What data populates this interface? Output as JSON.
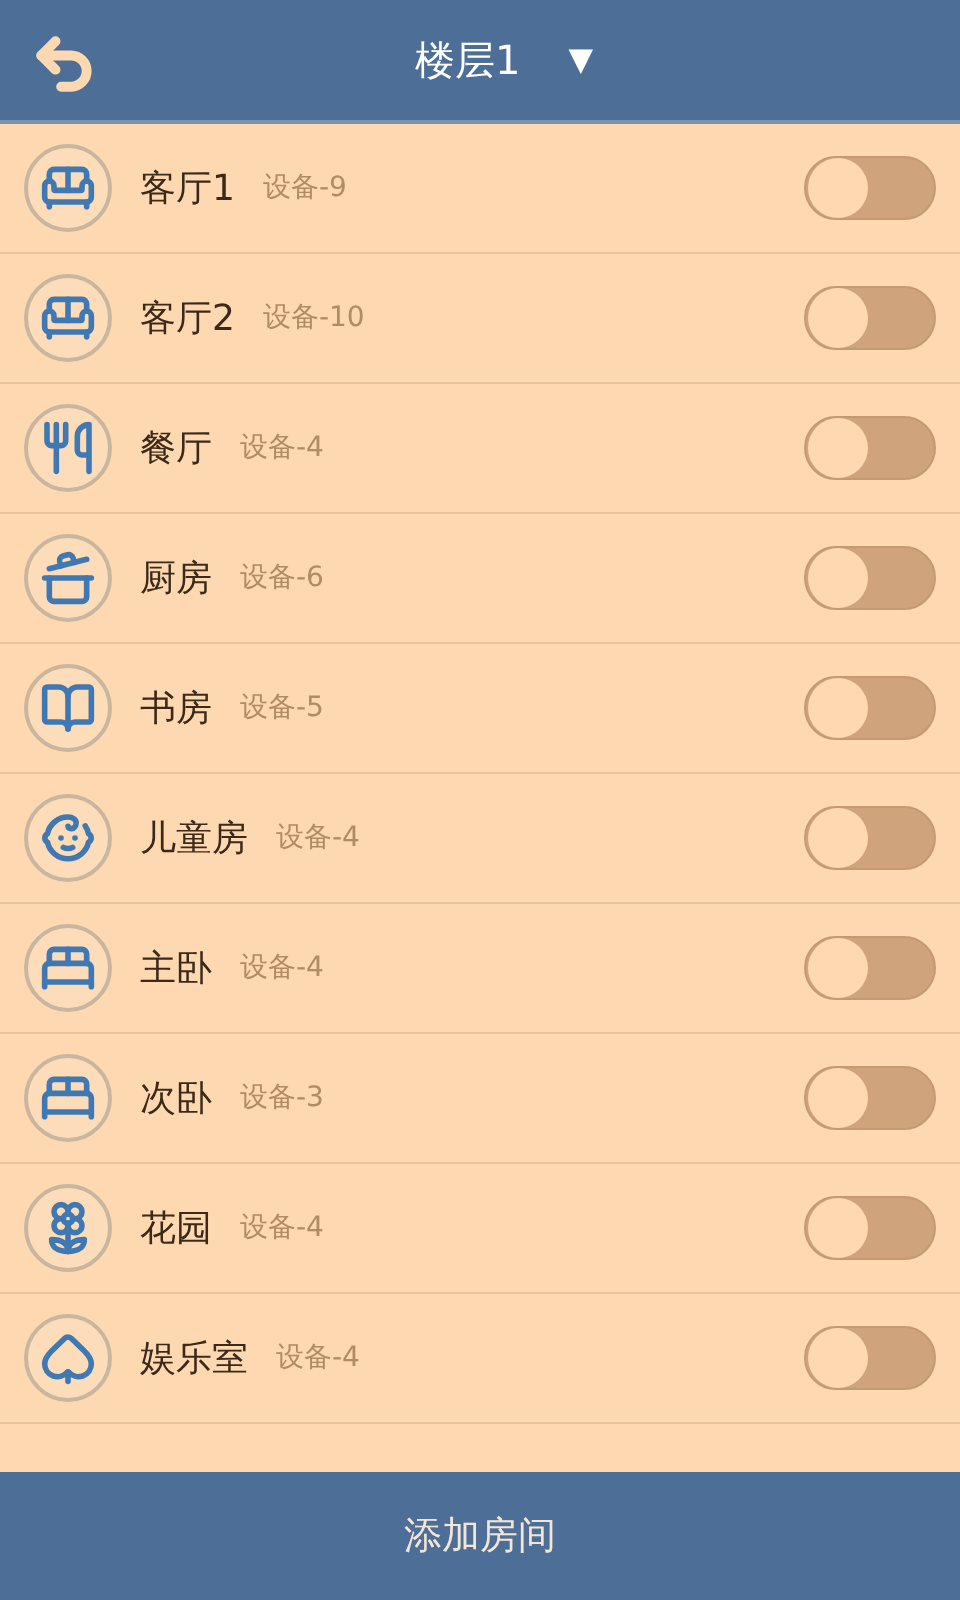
{
  "header": {
    "title": "楼层1",
    "dropdown_glyph": "▼"
  },
  "rooms": [
    {
      "name": "客厅1",
      "devices": "设备-9",
      "kind": "sofa",
      "on": false
    },
    {
      "name": "客厅2",
      "devices": "设备-10",
      "kind": "sofa",
      "on": false
    },
    {
      "name": "餐厅",
      "devices": "设备-4",
      "kind": "dining",
      "on": false
    },
    {
      "name": "厨房",
      "devices": "设备-6",
      "kind": "kitchen",
      "on": false
    },
    {
      "name": "书房",
      "devices": "设备-5",
      "kind": "study",
      "on": false
    },
    {
      "name": "儿童房",
      "devices": "设备-4",
      "kind": "kids",
      "on": false
    },
    {
      "name": "主卧",
      "devices": "设备-4",
      "kind": "bed",
      "on": false
    },
    {
      "name": "次卧",
      "devices": "设备-3",
      "kind": "bed",
      "on": false
    },
    {
      "name": "花园",
      "devices": "设备-4",
      "kind": "garden",
      "on": false
    },
    {
      "name": "娱乐室",
      "devices": "设备-4",
      "kind": "games",
      "on": false
    }
  ],
  "footer": {
    "button": "添加房间"
  }
}
